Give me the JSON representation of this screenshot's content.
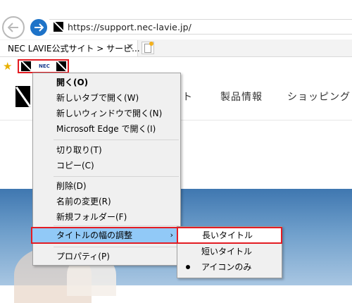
{
  "browser": {
    "url": "https://support.nec-lavie.jp/",
    "tab_title": "NEC LAVIE公式サイト > サービ...",
    "tab_close": "✕"
  },
  "favorites_bar": {
    "items": [
      {
        "label": "NEC"
      }
    ]
  },
  "page": {
    "nav_items": [
      "ト",
      "製品情報",
      "ショッピング"
    ]
  },
  "context_menu": {
    "items": [
      {
        "label": "開く(O)"
      },
      {
        "label": "新しいタブで開く(W)"
      },
      {
        "label": "新しいウィンドウで開く(N)"
      },
      {
        "label": "Microsoft Edge で開く(I)"
      },
      {
        "label": "切り取り(T)"
      },
      {
        "label": "コピー(C)"
      },
      {
        "label": "削除(D)"
      },
      {
        "label": "名前の変更(R)"
      },
      {
        "label": "新規フォルダー(F)"
      },
      {
        "label": "タイトルの幅の調整",
        "arrow": "›"
      },
      {
        "label": "プロパティ(P)"
      }
    ]
  },
  "submenu": {
    "items": [
      {
        "label": "長いタイトル"
      },
      {
        "label": "短いタイトル"
      },
      {
        "label": "アイコンのみ",
        "selected": true
      }
    ]
  },
  "colors": {
    "highlight_border": "#e31c23",
    "menu_highlight": "#91c9f7",
    "forward_button": "#1e73c8"
  }
}
